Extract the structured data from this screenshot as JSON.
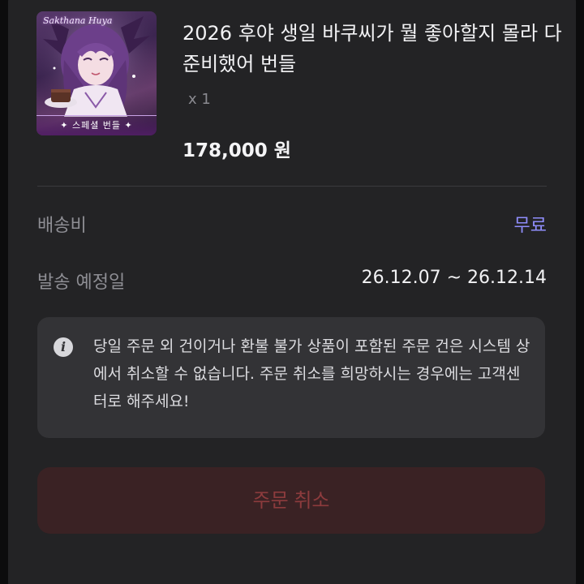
{
  "product": {
    "thumbnail": {
      "title": "Sakthana Huya",
      "banner": "✦ 스페셜 번들 ✦"
    },
    "name": "2026 후야 생일 바쿠씨가 뭘 좋아할지 몰라 다 준비했어 번들",
    "quantity": "x 1",
    "price": "178,000 원"
  },
  "shipping": {
    "fee_label": "배송비",
    "fee_value": "무료",
    "date_label": "발송 예정일",
    "date_value": "26.12.07 ~ 26.12.14"
  },
  "notice": {
    "icon": "info-icon",
    "text": "당일 주문 외 건이거나 환불 불가 상품이 포함된 주문 건은 시스템 상에서 취소할 수 없습니다. 주문 취소를 희망하시는 경우에는 고객센터로 해주세요!"
  },
  "actions": {
    "cancel_label": "주문 취소"
  },
  "colors": {
    "background": "#0c0c0d",
    "card": "#232325",
    "accent_free": "#8f8dfb",
    "cancel_text": "#8c3b3d",
    "cancel_bg": "#3a2224"
  }
}
